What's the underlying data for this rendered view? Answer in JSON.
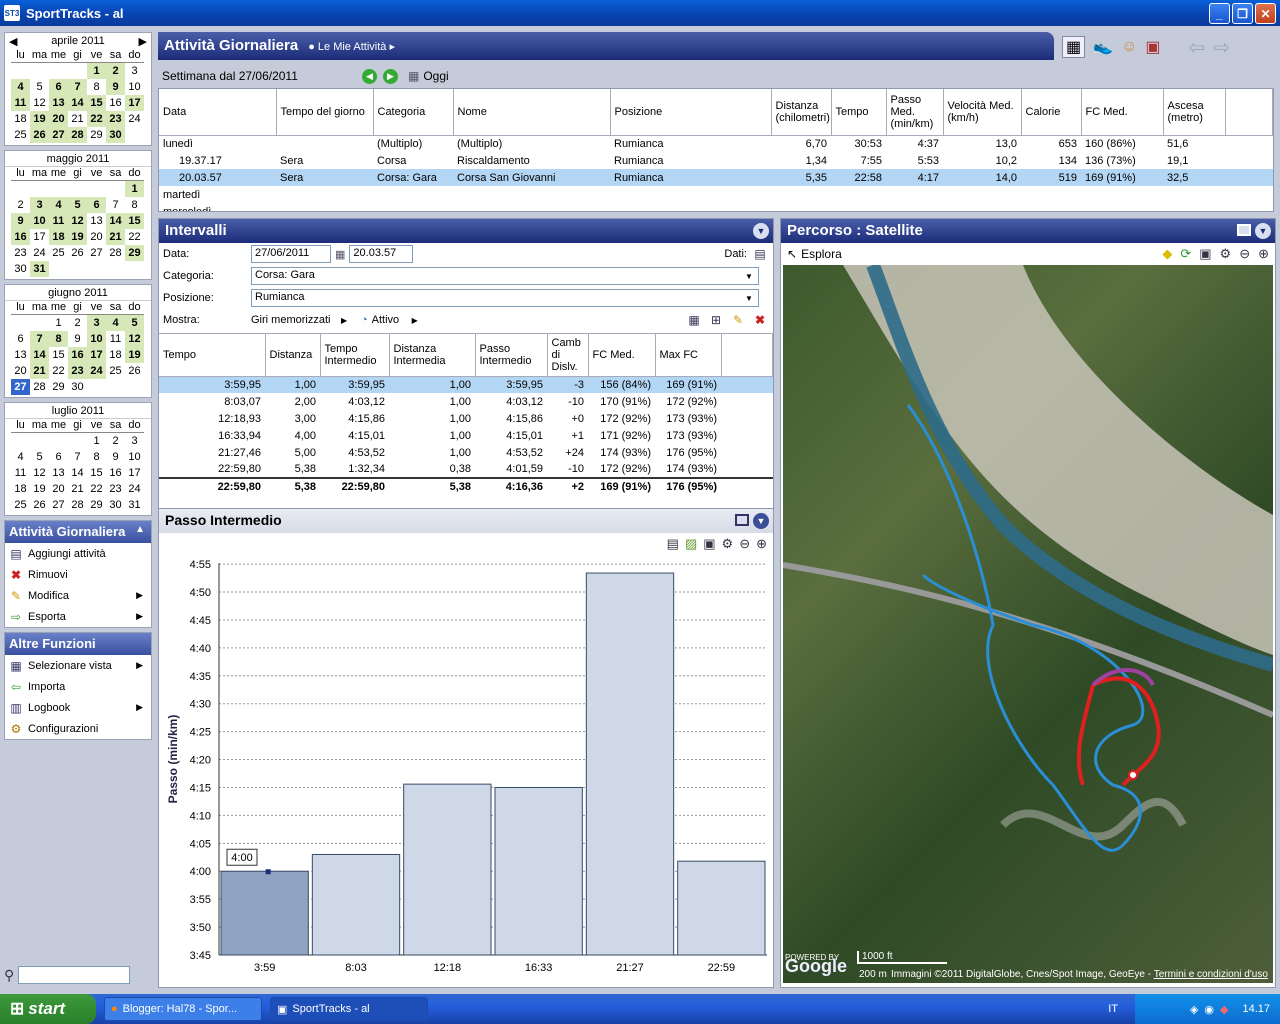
{
  "window": {
    "title": "SportTracks - al",
    "icon": "ST3"
  },
  "calendars": [
    {
      "month": "aprile 2011",
      "days": [
        [
          "",
          "",
          "",
          "",
          "1",
          "2",
          "3"
        ],
        [
          "4",
          "5",
          "6",
          "7",
          "8",
          "9",
          "10"
        ],
        [
          "11",
          "12",
          "13",
          "14",
          "15",
          "16",
          "17"
        ],
        [
          "18",
          "19",
          "20",
          "21",
          "22",
          "23",
          "24"
        ],
        [
          "25",
          "26",
          "27",
          "28",
          "29",
          "30",
          ""
        ]
      ],
      "active": [
        "1",
        "2",
        "4",
        "6",
        "7",
        "9",
        "11",
        "13",
        "14",
        "15",
        "17",
        "19",
        "20",
        "22",
        "23",
        "26",
        "27",
        "28",
        "30"
      ]
    },
    {
      "month": "maggio 2011",
      "days": [
        [
          "",
          "",
          "",
          "",
          "",
          "",
          "1"
        ],
        [
          "2",
          "3",
          "4",
          "5",
          "6",
          "7",
          "8"
        ],
        [
          "9",
          "10",
          "11",
          "12",
          "13",
          "14",
          "15"
        ],
        [
          "16",
          "17",
          "18",
          "19",
          "20",
          "21",
          "22"
        ],
        [
          "23",
          "24",
          "25",
          "26",
          "27",
          "28",
          "29"
        ],
        [
          "30",
          "31",
          "",
          "",
          "",
          "",
          ""
        ]
      ],
      "active": [
        "1",
        "3",
        "4",
        "5",
        "6",
        "9",
        "10",
        "11",
        "12",
        "14",
        "15",
        "16",
        "18",
        "19",
        "21",
        "29",
        "31"
      ]
    },
    {
      "month": "giugno 2011",
      "days": [
        [
          "",
          "",
          "1",
          "2",
          "3",
          "4",
          "5"
        ],
        [
          "6",
          "7",
          "8",
          "9",
          "10",
          "11",
          "12"
        ],
        [
          "13",
          "14",
          "15",
          "16",
          "17",
          "18",
          "19"
        ],
        [
          "20",
          "21",
          "22",
          "23",
          "24",
          "25",
          "26"
        ],
        [
          "27",
          "28",
          "29",
          "30",
          "",
          "",
          ""
        ]
      ],
      "active": [
        "3",
        "4",
        "5",
        "7",
        "8",
        "10",
        "12",
        "14",
        "16",
        "17",
        "19",
        "21",
        "23",
        "24"
      ],
      "selected": "27"
    },
    {
      "month": "luglio 2011",
      "days": [
        [
          "",
          "",
          "",
          "",
          "1",
          "2",
          "3"
        ],
        [
          "4",
          "5",
          "6",
          "7",
          "8",
          "9",
          "10"
        ],
        [
          "11",
          "12",
          "13",
          "14",
          "15",
          "16",
          "17"
        ],
        [
          "18",
          "19",
          "20",
          "21",
          "22",
          "23",
          "24"
        ],
        [
          "25",
          "26",
          "27",
          "28",
          "29",
          "30",
          "31"
        ]
      ],
      "active": []
    }
  ],
  "weekdays": [
    "lu",
    "ma",
    "me",
    "gi",
    "ve",
    "sa",
    "do"
  ],
  "side_activities": {
    "title": "Attività Giornaliera",
    "items": [
      "Aggiungi attività",
      "Rimuovi",
      "Modifica",
      "Esporta"
    ]
  },
  "side_functions": {
    "title": "Altre Funzioni",
    "items": [
      "Selezionare vista",
      "Importa",
      "Logbook",
      "Configurazioni"
    ]
  },
  "activity": {
    "title": "Attività Giornaliera",
    "breadcrumb": "Le Mie Attività",
    "week": "Settimana dal 27/06/2011",
    "today": "Oggi",
    "columns": [
      "Data",
      "Tempo del giorno",
      "Categoria",
      "Nome",
      "Posizione",
      "Distanza (chilometri)",
      "Tempo",
      "Passo Med. (min/km)",
      "Velocità Med. (km/h)",
      "Calorie",
      "FC Med.",
      "Ascesa (metro)"
    ],
    "rows": [
      [
        "lunedì",
        "",
        "(Multiplo)",
        "(Multiplo)",
        "Rumianca",
        "6,70",
        "30:53",
        "4:37",
        "13,0",
        "653",
        "160 (86%)",
        "51,6"
      ],
      [
        "19.37.17",
        "Sera",
        "Corsa",
        "Riscaldamento",
        "Rumianca",
        "1,34",
        "7:55",
        "5:53",
        "10,2",
        "134",
        "136 (73%)",
        "19,1"
      ],
      [
        "20.03.57",
        "Sera",
        "Corsa: Gara",
        "Corsa San Giovanni",
        "Rumianca",
        "5,35",
        "22:58",
        "4:17",
        "14,0",
        "519",
        "169 (91%)",
        "32,5"
      ],
      [
        "martedì",
        "",
        "",
        "",
        "",
        "",
        "",
        "",
        "",
        "",
        "",
        ""
      ],
      [
        "mercoledì",
        "",
        "",
        "",
        "",
        "",
        "",
        "",
        "",
        "",
        "",
        ""
      ]
    ]
  },
  "intervals": {
    "title": "Intervalli",
    "lbl_data": "Data:",
    "date": "27/06/2011",
    "time": "20.03.57",
    "lbl_dati": "Dati:",
    "lbl_categoria": "Categoria:",
    "categoria": "Corsa: Gara",
    "lbl_posizione": "Posizione:",
    "posizione": "Rumianca",
    "lbl_mostra": "Mostra:",
    "mostra": "Giri memorizzati",
    "attivo": "Attivo",
    "columns": [
      "Tempo",
      "Distanza",
      "Tempo Intermedio",
      "Distanza Intermedia",
      "Passo Intermedio",
      "Camb di Dislv.",
      "FC Med.",
      "Max FC"
    ],
    "rows": [
      [
        "3:59,95",
        "1,00",
        "3:59,95",
        "1,00",
        "3:59,95",
        "-3",
        "156 (84%)",
        "169 (91%)"
      ],
      [
        "8:03,07",
        "2,00",
        "4:03,12",
        "1,00",
        "4:03,12",
        "-10",
        "170 (91%)",
        "172 (92%)"
      ],
      [
        "12:18,93",
        "3,00",
        "4:15,86",
        "1,00",
        "4:15,86",
        "+0",
        "172 (92%)",
        "173 (93%)"
      ],
      [
        "16:33,94",
        "4,00",
        "4:15,01",
        "1,00",
        "4:15,01",
        "+1",
        "171 (92%)",
        "173 (93%)"
      ],
      [
        "21:27,46",
        "5,00",
        "4:53,52",
        "1,00",
        "4:53,52",
        "+24",
        "174 (93%)",
        "176 (95%)"
      ],
      [
        "22:59,80",
        "5,38",
        "1:32,34",
        "0,38",
        "4:01,59",
        "-10",
        "172 (92%)",
        "174 (93%)"
      ]
    ],
    "total": [
      "22:59,80",
      "5,38",
      "22:59,80",
      "5,38",
      "4:16,36",
      "+2",
      "169 (91%)",
      "176 (95%)"
    ]
  },
  "chart_panel": {
    "title": "Passo Intermedio"
  },
  "chart_data": {
    "type": "bar",
    "categories": [
      "3:59",
      "8:03",
      "12:18",
      "16:33",
      "21:27",
      "22:59"
    ],
    "values": [
      4.0,
      4.05,
      4.26,
      4.25,
      4.89,
      4.03
    ],
    "tooltip": "4:00",
    "ylabel": "Passo (min/km)",
    "ylim": [
      3.75,
      4.92
    ],
    "yticks": [
      "3:45",
      "3:50",
      "3:55",
      "4:00",
      "4:05",
      "4:10",
      "4:15",
      "4:20",
      "4:25",
      "4:30",
      "4:35",
      "4:40",
      "4:45",
      "4:50",
      "4:55"
    ],
    "grid": true
  },
  "map": {
    "title": "Percorso  : Satellite",
    "explore": "Esplora",
    "scale": "1000 ft",
    "scale2": "200 m",
    "copyright": "Immagini ©2011 DigitalGlobe, Cnes/Spot Image, GeoEye -",
    "terms": "Termini e condizioni d'uso",
    "powered": "POWERED BY",
    "logo": "Google"
  },
  "taskbar": {
    "start": "start",
    "tasks": [
      "Blogger: Hal78 - Spor...",
      "SportTracks - al"
    ],
    "lang": "IT",
    "clock": "14.17"
  }
}
